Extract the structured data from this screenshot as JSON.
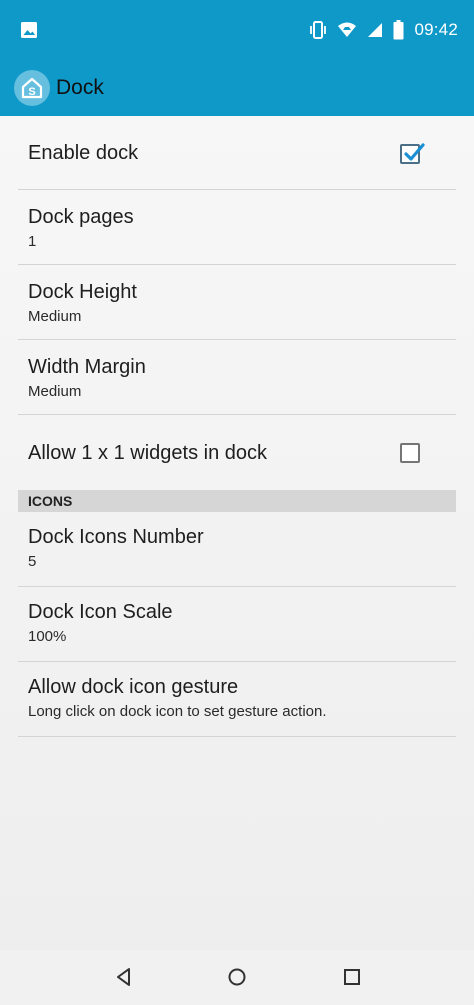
{
  "status_bar": {
    "time": "09:42",
    "icons": [
      "image-icon",
      "vibrate-icon",
      "wifi-icon",
      "signal-icon",
      "battery-icon"
    ]
  },
  "app_bar": {
    "title": "Dock",
    "logo_letter": "S"
  },
  "settings": {
    "enable_dock": {
      "title": "Enable dock",
      "checked": true
    },
    "dock_pages": {
      "title": "Dock pages",
      "value": "1"
    },
    "dock_height": {
      "title": "Dock Height",
      "value": "Medium"
    },
    "width_margin": {
      "title": "Width Margin",
      "value": "Medium"
    },
    "allow_widgets": {
      "title": "Allow 1 x 1 widgets in dock",
      "checked": false
    },
    "icons_section": {
      "label": "ICONS"
    },
    "dock_icons_number": {
      "title": "Dock Icons Number",
      "value": "5"
    },
    "dock_icon_scale": {
      "title": "Dock Icon Scale",
      "value": "100%"
    },
    "dock_icon_gesture": {
      "title": "Allow dock icon gesture",
      "summary": "Long click on dock icon to set gesture action."
    }
  },
  "nav_bar": {
    "buttons": [
      "back-icon",
      "home-icon",
      "recents-icon"
    ]
  },
  "colors": {
    "accent": "#0e99c9",
    "checkbox_checked": "#1a8fd4"
  }
}
